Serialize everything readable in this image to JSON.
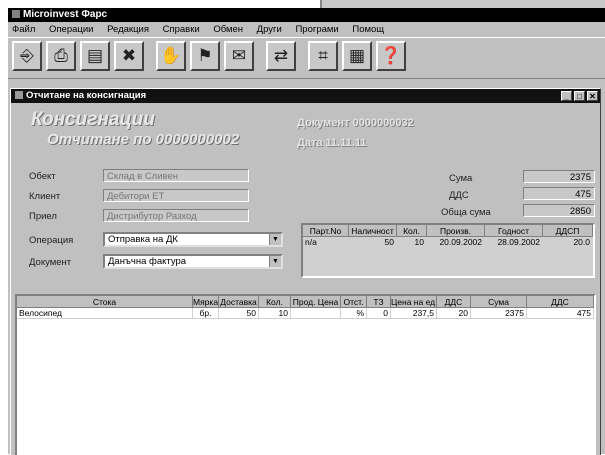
{
  "window": {
    "title": "Microinvest Фарс"
  },
  "menu": [
    "Файл",
    "Операции",
    "Редакция",
    "Справки",
    "Обмен",
    "Други",
    "Програми",
    "Помощ"
  ],
  "toolbar": {
    "icons": [
      "exit-icon",
      "print-icon",
      "cards-icon",
      "delete-icon",
      "sale-icon",
      "delivery-icon",
      "documents-icon",
      "transfer-icon",
      "calculator-icon",
      "catalog-icon",
      "help-icon"
    ]
  },
  "child": {
    "title": "Отчитане на консигнация"
  },
  "header": {
    "heading": "Консигнации",
    "subheading": "Отчитане по 0000000002"
  },
  "doc_info": {
    "line1": "Документ 0000000032",
    "line2": "Дата 11.11.11"
  },
  "form": {
    "object_label": "Обект",
    "object_value": "Склад в Сливен",
    "client_label": "Клиент",
    "client_value": "Дебитори ЕТ",
    "trader_label": "Приел",
    "trader_value": "Дистрибутор Разход",
    "operation_label": "Операция",
    "operation_value": "Отпрaвка на ДК",
    "document_label": "Документ",
    "document_value": "Данъчна фактура"
  },
  "summary": {
    "sum_label": "Сума",
    "sum_value": "2375",
    "vat_label": "ДДС",
    "vat_value": "475",
    "total_label": "Обща сума",
    "total_value": "2850"
  },
  "lots": {
    "columns": [
      "Парт.No",
      "Наличност",
      "Кол.",
      "Произв.",
      "Годност",
      "ДДСП"
    ],
    "rows": [
      [
        "n/a",
        "50",
        "10",
        "20.09.2002",
        "28.09.2002",
        "20.0"
      ]
    ]
  },
  "items": {
    "columns": [
      "Стока",
      "Мярка",
      "Доставка",
      "Кол.",
      "Прод. Цена",
      "Отст.",
      "ТЗ",
      "Цена на ед.",
      "ДДС",
      "Сума",
      "ДДС"
    ],
    "rows": [
      [
        "Велосипед",
        "бр.",
        "50",
        "10",
        "",
        "%",
        "0",
        "237,5",
        "20",
        "2375",
        "475"
      ]
    ]
  }
}
